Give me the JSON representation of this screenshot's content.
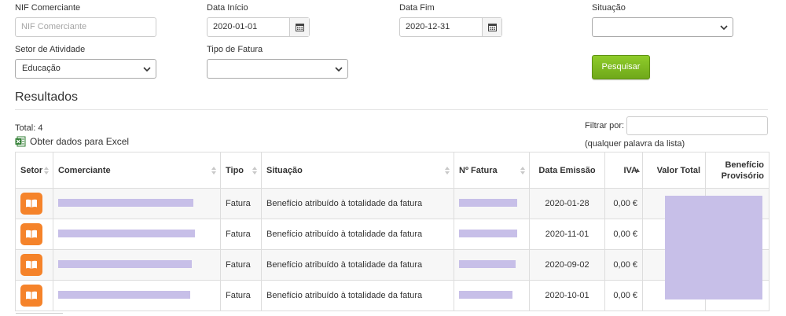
{
  "filters": {
    "nif": {
      "label": "NIF Comerciante",
      "placeholder": "NIF Comerciante"
    },
    "data_inicio": {
      "label": "Data Início",
      "value": "2020-01-01"
    },
    "data_fim": {
      "label": "Data Fim",
      "value": "2020-12-31"
    },
    "situacao": {
      "label": "Situação",
      "value": ""
    },
    "setor": {
      "label": "Setor de Atividade",
      "value": "Educação"
    },
    "tipo_fatura": {
      "label": "Tipo de Fatura",
      "value": ""
    },
    "search_button": "Pesquisar"
  },
  "results": {
    "title": "Resultados",
    "total": "Total: 4",
    "excel_link": "Obter dados para Excel",
    "filter_label": "Filtrar por:",
    "filter_hint": "(qualquer palavra da lista)",
    "filter_value": ""
  },
  "table": {
    "headers": [
      "Setor",
      "Comerciante",
      "Tipo",
      "Situação",
      "Nº Fatura",
      "Data Emissão",
      "IVA",
      "Valor Total",
      "Benefício Provisório"
    ],
    "rows": [
      {
        "tipo": "Fatura",
        "situacao": "Benefício atribuído à totalidade da fatura",
        "data": "2020-01-28",
        "iva": "0,00 €"
      },
      {
        "tipo": "Fatura",
        "situacao": "Benefício atribuído à totalidade da fatura",
        "data": "2020-11-01",
        "iva": "0,00 €"
      },
      {
        "tipo": "Fatura",
        "situacao": "Benefício atribuído à totalidade da fatura",
        "data": "2020-09-02",
        "iva": "0,00 €"
      },
      {
        "tipo": "Fatura",
        "situacao": "Benefício atribuído à totalidade da fatura",
        "data": "2020-10-01",
        "iva": "0,00 €"
      }
    ]
  },
  "colors": {
    "accent_green": "#7cb91f",
    "sector_orange": "#f5832a",
    "redaction": "#c7bfe8"
  },
  "icons": {
    "calendar": "calendar-icon",
    "chevron": "chevron-down-icon",
    "excel": "excel-icon",
    "sector": "book-icon",
    "sort": "sort-icon"
  }
}
